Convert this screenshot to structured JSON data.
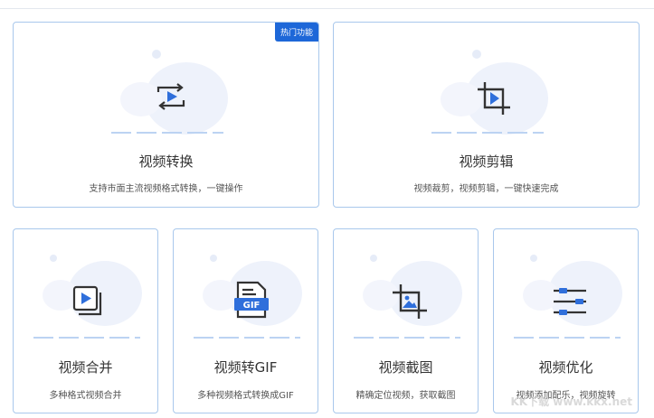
{
  "cards": [
    {
      "title": "视频转换",
      "desc": "支持市面主流视频格式转换，一键操作",
      "icon": "convert-icon",
      "badge": "热门功能"
    },
    {
      "title": "视频剪辑",
      "desc": "视频裁剪，视频剪辑，一键快速完成",
      "icon": "crop-icon"
    },
    {
      "title": "视频合并",
      "desc": "多种格式视频合并",
      "icon": "merge-icon"
    },
    {
      "title": "视频转GIF",
      "desc": "多种视频格式转换成GIF",
      "icon": "gif-icon",
      "icon_text": "GIF"
    },
    {
      "title": "视频截图",
      "desc": "精确定位视频，获取截图",
      "icon": "screenshot-icon"
    },
    {
      "title": "视频优化",
      "desc": "视频添加配乐，视频旋转",
      "icon": "sliders-icon"
    }
  ],
  "watermark": "KK下载 www.kkx.net",
  "colors": {
    "accent": "#1d67d8",
    "card_border": "#a9c8ec",
    "icon_stroke": "#333333",
    "icon_fill": "#2f6fdb"
  }
}
